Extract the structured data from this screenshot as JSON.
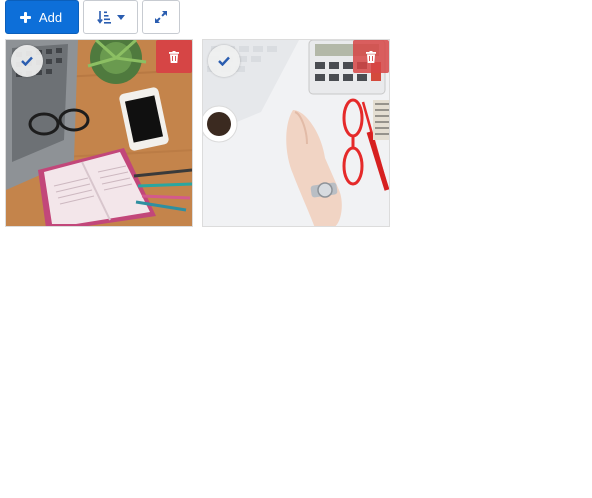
{
  "toolbar": {
    "add_label": "Add",
    "icons": {
      "add": "plus-icon",
      "sort": "sort-amount-icon",
      "expand": "expand-arrows-icon"
    }
  },
  "gallery": {
    "items": [
      {
        "selected": false,
        "icons": [
          "check-icon",
          "trash-icon"
        ]
      },
      {
        "selected": false,
        "icons": [
          "check-icon",
          "trash-icon"
        ]
      }
    ]
  },
  "colors": {
    "primary": "#0d6fd9",
    "danger": "#d64545",
    "outline_border": "#c7cbd1",
    "icon_blue": "#2a5db0"
  }
}
